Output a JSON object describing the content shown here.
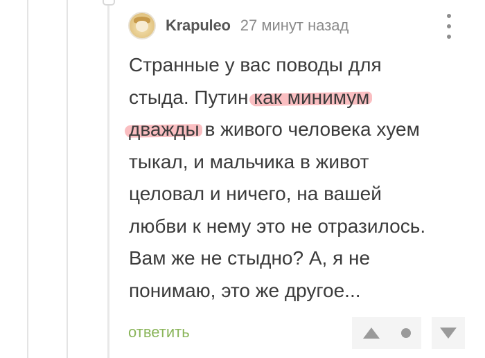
{
  "comment": {
    "author": "Krapuleo",
    "timestamp": "27 минут назад",
    "body_lines": [
      {
        "before": "Странные у вас поводы для",
        "highlight": "",
        "after": ""
      },
      {
        "before": "стыда. Путин ",
        "highlight": "как минимум",
        "after": ""
      },
      {
        "before": "",
        "highlight": "дважды",
        "after": " в живого человека хуем"
      },
      {
        "before": "тыкал, и мальчика в живот",
        "highlight": "",
        "after": ""
      },
      {
        "before": "целовал и ничего, на вашей",
        "highlight": "",
        "after": ""
      },
      {
        "before": "любви к нему это не отразилось.",
        "highlight": "",
        "after": ""
      },
      {
        "before": "Вам же не стыдно? А, я не",
        "highlight": "",
        "after": ""
      },
      {
        "before": "понимаю, это же другое...",
        "highlight": "",
        "after": ""
      }
    ],
    "highlight_color": "#f8a8ac"
  },
  "actions": {
    "reply_label": "ответить",
    "reply_color": "#8ab55a"
  },
  "icons": {
    "avatar": "avatar-image",
    "more": "vertical-dots-icon",
    "upvote": "arrow-up-icon",
    "rating": "dot-icon",
    "downvote": "arrow-down-icon"
  }
}
